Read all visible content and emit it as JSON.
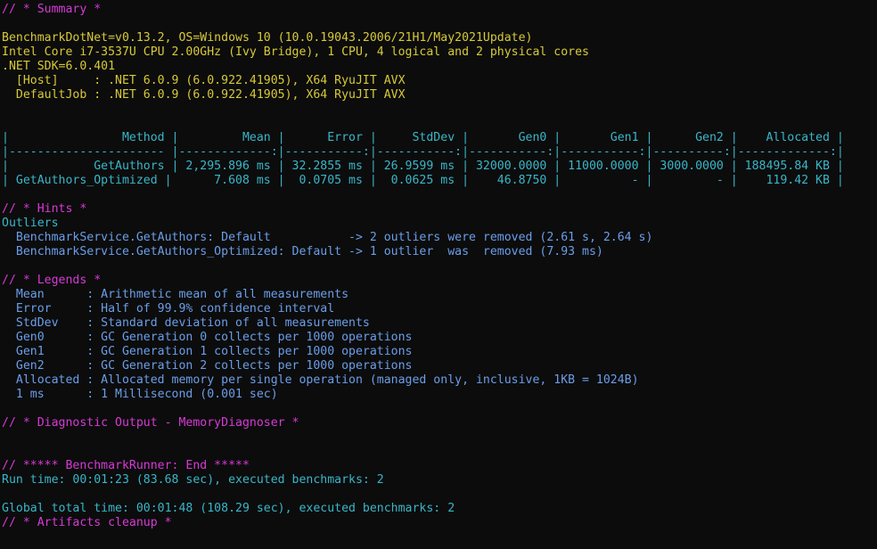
{
  "window": {
    "colors": {
      "background": "#0c0c0c",
      "magenta": "#d63ad6",
      "yellow": "#d7c93a",
      "cyan": "#3ab6c8",
      "blue": "#6b9ee8",
      "white": "#cfcfcf"
    }
  },
  "lines": [
    {
      "text": "// * Summary *",
      "color": "magenta"
    },
    {
      "text": "",
      "color": "white"
    },
    {
      "text": "BenchmarkDotNet=v0.13.2, OS=Windows 10 (10.0.19043.2006/21H1/May2021Update)",
      "color": "yellow"
    },
    {
      "text": "Intel Core i7-3537U CPU 2.00GHz (Ivy Bridge), 1 CPU, 4 logical and 2 physical cores",
      "color": "yellow"
    },
    {
      "text": ".NET SDK=6.0.401",
      "color": "yellow"
    },
    {
      "text": "  [Host]     : .NET 6.0.9 (6.0.922.41905), X64 RyuJIT AVX",
      "color": "yellow"
    },
    {
      "text": "  DefaultJob : .NET 6.0.9 (6.0.922.41905), X64 RyuJIT AVX",
      "color": "yellow"
    },
    {
      "text": "",
      "color": "white"
    },
    {
      "text": "",
      "color": "white"
    },
    {
      "text": "|                Method |         Mean |      Error |     StdDev |       Gen0 |       Gen1 |      Gen2 |    Allocated |",
      "color": "cyan"
    },
    {
      "text": "|---------------------- |-------------:|-----------:|-----------:|-----------:|-----------:|----------:|-------------:|",
      "color": "cyan"
    },
    {
      "text": "|            GetAuthors | 2,295.896 ms | 32.2855 ms | 26.9599 ms | 32000.0000 | 11000.0000 | 3000.0000 | 188495.84 KB |",
      "color": "cyan"
    },
    {
      "text": "| GetAuthors_Optimized |      7.608 ms |  0.0705 ms |  0.0625 ms |    46.8750 |          - |         - |    119.42 KB |",
      "color": "cyan"
    },
    {
      "text": "",
      "color": "white"
    },
    {
      "text": "// * Hints *",
      "color": "magenta"
    },
    {
      "text": "Outliers",
      "color": "cyan"
    },
    {
      "text": "  BenchmarkService.GetAuthors: Default           -> 2 outliers were removed (2.61 s, 2.64 s)",
      "color": "blue"
    },
    {
      "text": "  BenchmarkService.GetAuthors_Optimized: Default -> 1 outlier  was  removed (7.93 ms)",
      "color": "blue"
    },
    {
      "text": "",
      "color": "white"
    },
    {
      "text": "// * Legends *",
      "color": "magenta"
    },
    {
      "text": "  Mean      : Arithmetic mean of all measurements",
      "color": "blue"
    },
    {
      "text": "  Error     : Half of 99.9% confidence interval",
      "color": "blue"
    },
    {
      "text": "  StdDev    : Standard deviation of all measurements",
      "color": "blue"
    },
    {
      "text": "  Gen0      : GC Generation 0 collects per 1000 operations",
      "color": "blue"
    },
    {
      "text": "  Gen1      : GC Generation 1 collects per 1000 operations",
      "color": "blue"
    },
    {
      "text": "  Gen2      : GC Generation 2 collects per 1000 operations",
      "color": "blue"
    },
    {
      "text": "  Allocated : Allocated memory per single operation (managed only, inclusive, 1KB = 1024B)",
      "color": "blue"
    },
    {
      "text": "  1 ms      : 1 Millisecond (0.001 sec)",
      "color": "blue"
    },
    {
      "text": "",
      "color": "white"
    },
    {
      "text": "// * Diagnostic Output - MemoryDiagnoser *",
      "color": "magenta"
    },
    {
      "text": "",
      "color": "white"
    },
    {
      "text": "",
      "color": "white"
    },
    {
      "text": "// ***** BenchmarkRunner: End *****",
      "color": "magenta"
    },
    {
      "text": "Run time: 00:01:23 (83.68 sec), executed benchmarks: 2",
      "color": "cyan"
    },
    {
      "text": "",
      "color": "white"
    },
    {
      "text": "Global total time: 00:01:48 (108.29 sec), executed benchmarks: 2",
      "color": "cyan"
    },
    {
      "text": "// * Artifacts cleanup *",
      "color": "magenta"
    }
  ]
}
